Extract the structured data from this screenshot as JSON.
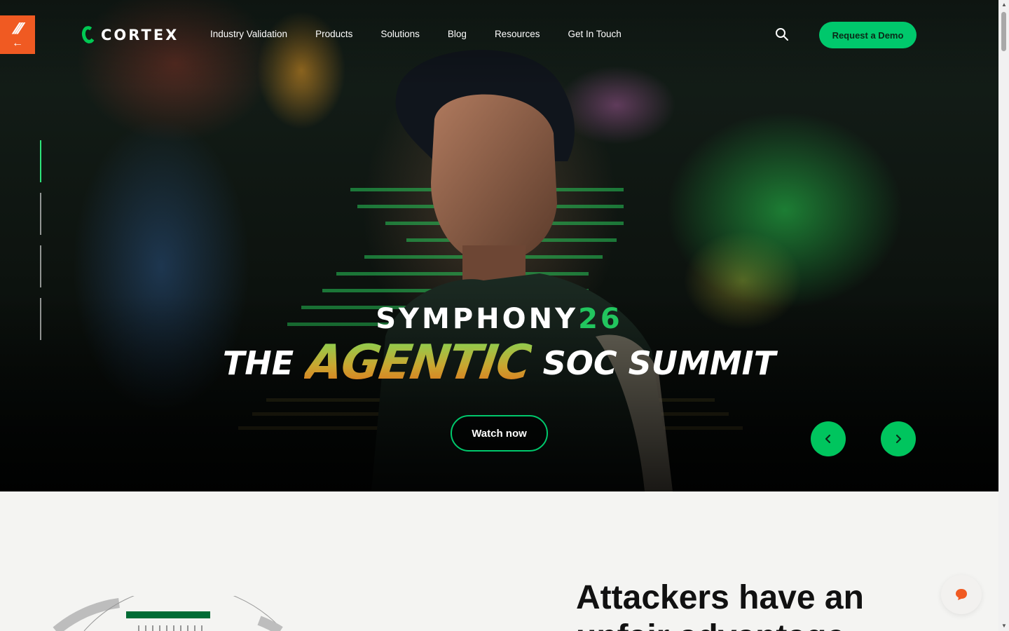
{
  "brand": {
    "name": "CORTEX",
    "accent": "#00c86c",
    "partner_badge_color": "#f05a22"
  },
  "nav": {
    "items": [
      "Industry Validation",
      "Products",
      "Solutions",
      "Blog",
      "Resources",
      "Get In Touch"
    ],
    "cta_label": "Request a Demo",
    "search_icon": "search-icon"
  },
  "hero": {
    "event_name": "SYMPHONY",
    "event_year": "26",
    "headline_prefix": "THE",
    "headline_emphasis": "AGENTIC",
    "headline_suffix": "SOC SUMMIT",
    "cta_label": "Watch now",
    "slide_count": 4,
    "active_slide": 1,
    "prev_icon": "chevron-left-icon",
    "next_icon": "chevron-right-icon"
  },
  "section": {
    "heading_line1": "Attackers have an",
    "heading_line2": "unfair advantage"
  },
  "chat": {
    "icon": "chat-bubble-icon",
    "color": "#f05a22"
  }
}
